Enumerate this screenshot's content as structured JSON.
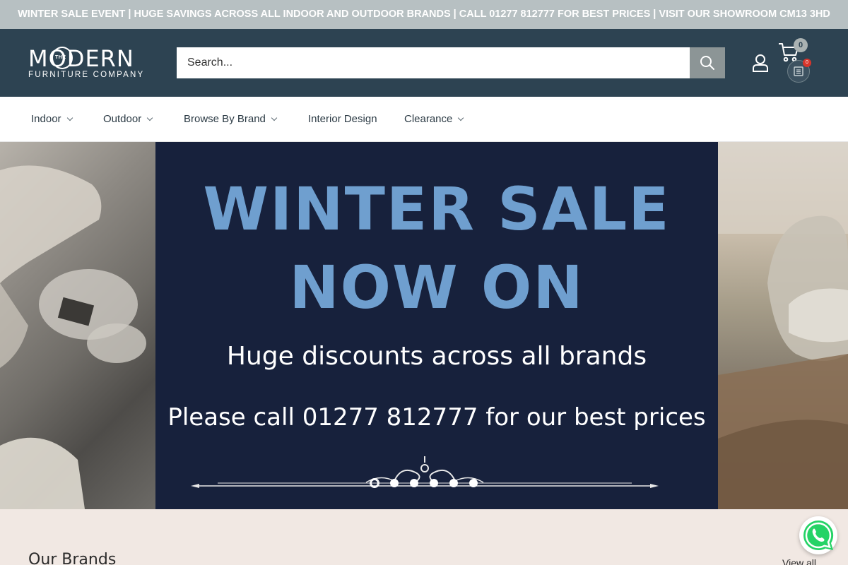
{
  "announcement": {
    "text": "WINTER SALE EVENT | HUGE SAVINGS ACROSS ALL INDOOR AND OUTDOOR BRANDS | CALL 01277 812777 FOR BEST PRICES | VISIT OUR SHOWROOM CM13 3HD"
  },
  "header": {
    "logo": {
      "the": "THE",
      "main": "MODERN",
      "sub": "FURNITURE COMPANY"
    },
    "search": {
      "placeholder": "Search..."
    },
    "cart_count": "0",
    "wishlist_count": "0",
    "icons": [
      "search-icon",
      "account-icon",
      "cart-icon",
      "wishlist-icon"
    ]
  },
  "nav": {
    "items": [
      {
        "label": "Indoor",
        "has_dropdown": true
      },
      {
        "label": "Outdoor",
        "has_dropdown": true
      },
      {
        "label": "Browse By Brand",
        "has_dropdown": true
      },
      {
        "label": "Interior Design",
        "has_dropdown": false
      },
      {
        "label": "Clearance",
        "has_dropdown": true
      }
    ]
  },
  "hero": {
    "title_line1": "WINTER SALE",
    "title_line2": "NOW ON",
    "subtitle1": "Huge discounts across all brands",
    "subtitle2": "Please call 01277 812777 for our best prices",
    "slide_count": 6,
    "active_slide": 1
  },
  "brands": {
    "title": "Our Brands",
    "view_all": "View all"
  },
  "colors": {
    "announcement_bg": "#b7c0c2",
    "header_bg": "#2d4352",
    "hero_bg": "#17213c",
    "hero_title": "#6f9fcf",
    "page_bg": "#f1e8e3",
    "whatsapp": "#25d366"
  }
}
